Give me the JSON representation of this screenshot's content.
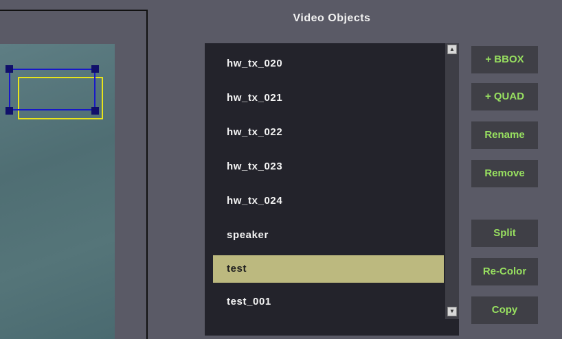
{
  "panel": {
    "title": "Video Objects"
  },
  "objects": [
    {
      "label": "hw_tx_020",
      "selected": false
    },
    {
      "label": "hw_tx_021",
      "selected": false
    },
    {
      "label": "hw_tx_022",
      "selected": false
    },
    {
      "label": "hw_tx_023",
      "selected": false
    },
    {
      "label": "hw_tx_024",
      "selected": false
    },
    {
      "label": "speaker",
      "selected": false
    },
    {
      "label": "test",
      "selected": true
    },
    {
      "label": "test_001",
      "selected": false
    }
  ],
  "buttons": {
    "add_bbox": "+ BBOX",
    "add_quad": "+ QUAD",
    "rename": "Rename",
    "remove": "Remove",
    "split": "Split",
    "recolor": "Re-Color",
    "copy": "Copy"
  },
  "icons": {
    "scroll_up": "scroll-up-arrow-icon",
    "scroll_down": "scroll-down-arrow-icon"
  },
  "colors": {
    "selected_row": "#bcb97f",
    "button_text": "#98e060",
    "bbox_blue": "#1818c8",
    "bbox_yellow": "#e8e41a"
  }
}
